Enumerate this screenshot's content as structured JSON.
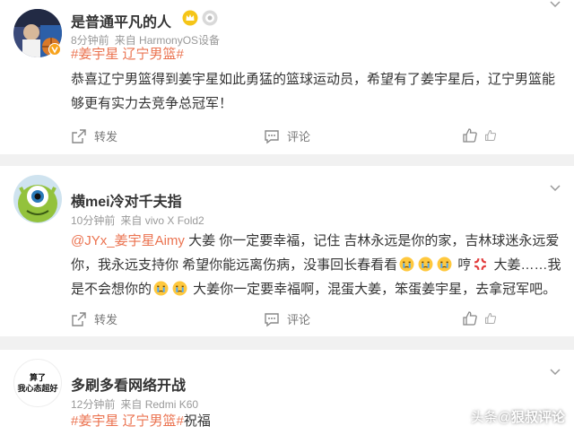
{
  "posts": [
    {
      "username": "是普通平凡的人",
      "time": "8分钟前",
      "source": "来自 HarmonyOS设备",
      "topic_line": [
        "#姜宇星",
        "辽宁男篮#"
      ],
      "content": "恭喜辽宁男篮得到姜宇星如此勇猛的篮球运动员，希望有了姜宇星后，辽宁男篮能够更有实力去竞争总冠军！",
      "actions": {
        "repost": "转发",
        "comment": "评论",
        "like": ""
      }
    },
    {
      "username": "横mei冷对千夫指",
      "time": "10分钟前",
      "source": "来自 vivo X Fold2",
      "mention": "@JYx_姜宇星Aimy",
      "content_a": " 大姜 你一定要幸福，记住 吉林永远是你的家，吉林球迷永远爱你，我永远支持你 希望你能远离伤病，没事回长春看看",
      "content_b": " 哼",
      "content_c": " 大姜……我是不会想你的",
      "content_d": " 大姜你一定要幸福啊，混蛋大姜，笨蛋姜宇星，去拿冠军吧。",
      "actions": {
        "repost": "转发",
        "comment": "评论",
        "like": ""
      }
    },
    {
      "username": "多刷多看网络开战",
      "time": "12分钟前",
      "source": "来自 Redmi K60",
      "avatar_text": [
        "算了",
        "我心态超好"
      ],
      "topic_a": "#姜宇星",
      "topic_b": "辽宁男篮#",
      "content": "祝福"
    }
  ],
  "watermark": {
    "prefix": "头条",
    "at": "@",
    "author": "狠叔评论"
  },
  "colors": {
    "accent": "#eb7350",
    "muted": "#999999",
    "background": "#f1f1f1"
  }
}
